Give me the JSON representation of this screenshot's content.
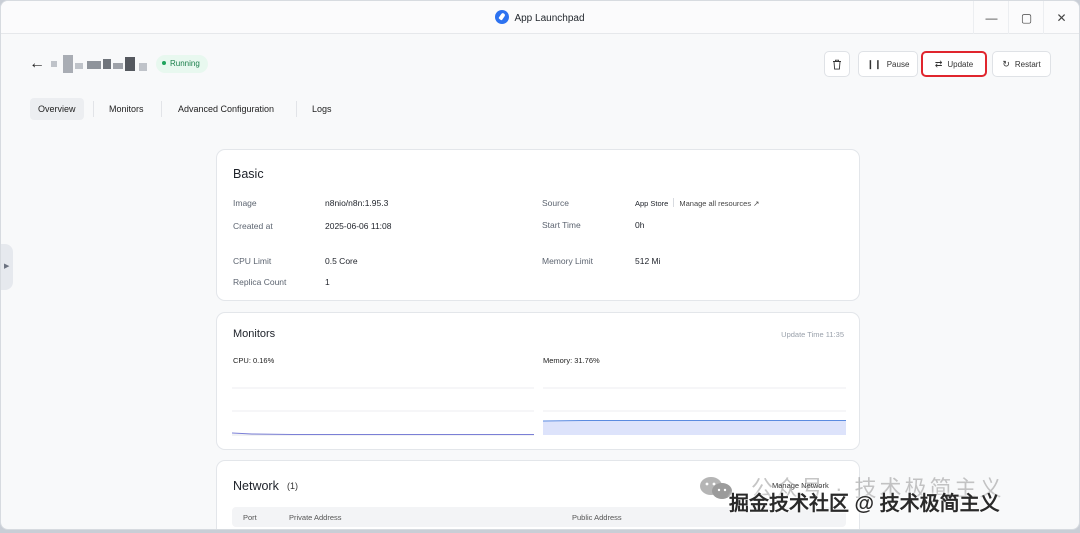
{
  "window": {
    "title": "App Launchpad",
    "controls": {
      "minimize": "—",
      "maximize": "▢",
      "close": "✕"
    }
  },
  "header": {
    "status": "Running",
    "actions": {
      "pause": "Pause",
      "update": "Update",
      "restart": "Restart"
    }
  },
  "tabs": [
    {
      "label": "Overview",
      "active": true
    },
    {
      "label": "Monitors",
      "active": false
    },
    {
      "label": "Advanced Configuration",
      "active": false
    },
    {
      "label": "Logs",
      "active": false
    }
  ],
  "basic": {
    "title": "Basic",
    "image_label": "Image",
    "image_value": "n8nio/n8n:1.95.3",
    "created_label": "Created at",
    "created_value": "2025-06-06 11:08",
    "cpu_label": "CPU Limit",
    "cpu_value": "0.5 Core",
    "replica_label": "Replica Count",
    "replica_value": "1",
    "source_label": "Source",
    "source_value": "App Store",
    "manage_resources": "Manage all resources ↗",
    "start_label": "Start Time",
    "start_value": "0h",
    "memory_label": "Memory Limit",
    "memory_value": "512 Mi"
  },
  "monitors": {
    "title": "Monitors",
    "update_time": "Update Time  11:35",
    "cpu_label": "CPU:  0.16%",
    "memory_label": "Memory:  31.76%",
    "colors": {
      "cpu": "#7b7fd6",
      "memory": "#5b8be0",
      "memory_fill": "#dde3fb"
    }
  },
  "network": {
    "title": "Network",
    "count": "(1)",
    "manage": "Manage Network",
    "columns": [
      "Port",
      "Private Address",
      "Public Address"
    ]
  },
  "watermark": {
    "top": "公众号 · 技术极简主义",
    "bottom": "掘金技术社区 @ 技术极简主义"
  }
}
